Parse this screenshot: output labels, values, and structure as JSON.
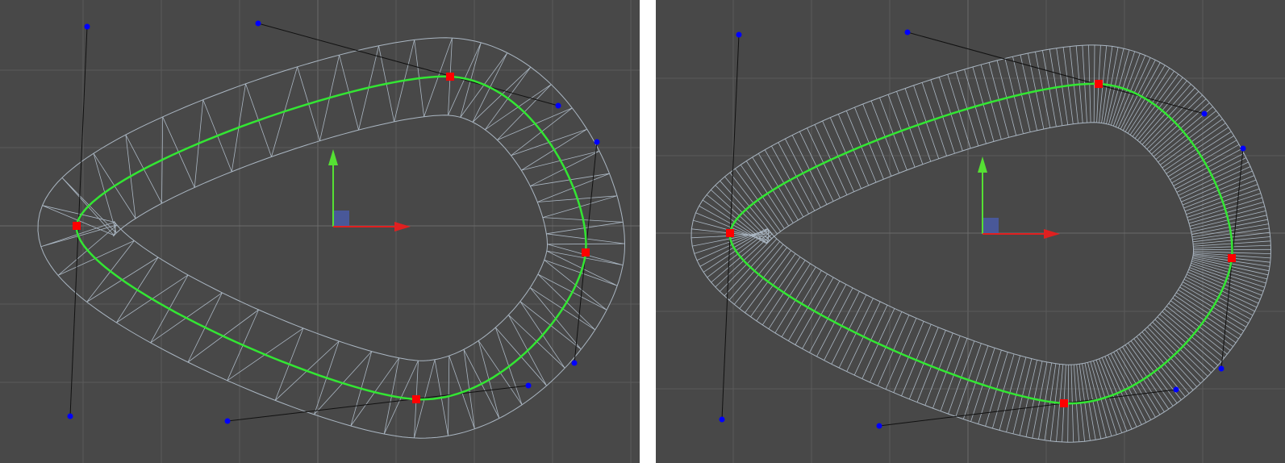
{
  "viewports": [
    {
      "id": "left",
      "mesh_resolution": "low"
    },
    {
      "id": "right",
      "mesh_resolution": "high"
    }
  ],
  "colors": {
    "background": "#484848",
    "grid_line": "#5a5a5a",
    "grid_axis": "#6a6a6a",
    "mesh_wire": "#aab6c2",
    "spline_curve": "#33e633",
    "anchor_point": "#ff0000",
    "tangent_handle": "#0000ff",
    "tangent_line": "#111111",
    "gizmo_x": "#e02020",
    "gizmo_y": "#55e033",
    "gizmo_center": "#4a5ca8"
  }
}
